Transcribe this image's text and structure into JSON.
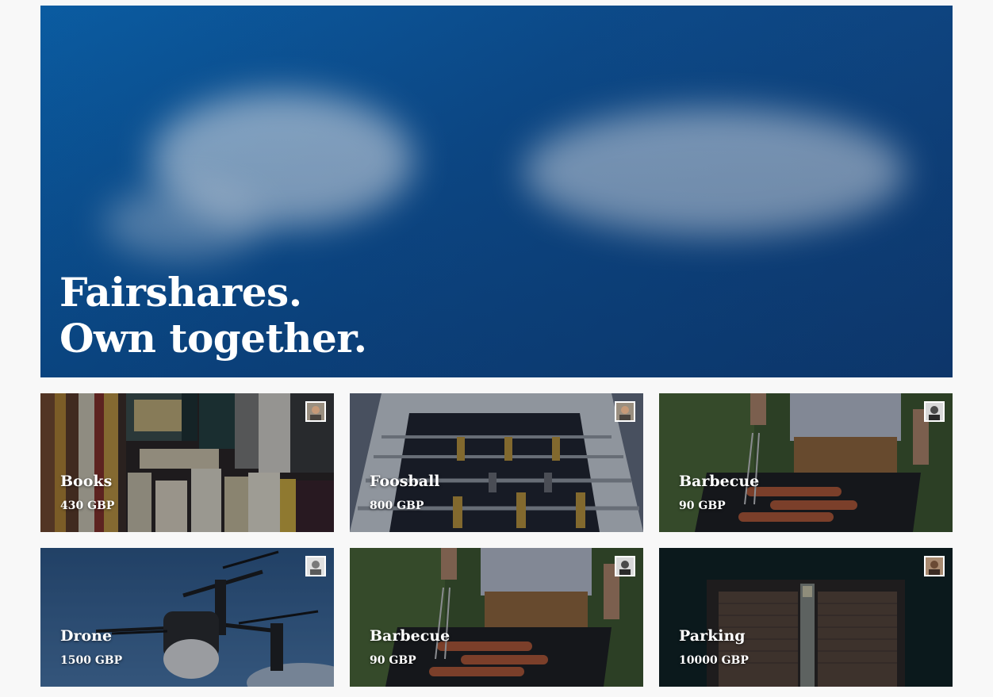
{
  "hero": {
    "line1": "Fairshares.",
    "line2": "Own together."
  },
  "listings": [
    {
      "name": "Books",
      "price": "430 GBP",
      "image": "books-shelf-photo",
      "owner_avatar": "user-avatar"
    },
    {
      "name": "Foosball",
      "price": "800 GBP",
      "image": "foosball-table-photo",
      "owner_avatar": "user-avatar"
    },
    {
      "name": "Barbecue",
      "price": "90 GBP",
      "image": "barbecue-grill-photo",
      "owner_avatar": "user-avatar"
    },
    {
      "name": "Drone",
      "price": "1500 GBP",
      "image": "drone-photo",
      "owner_avatar": "user-avatar"
    },
    {
      "name": "Barbecue",
      "price": "90 GBP",
      "image": "barbecue-grill-photo",
      "owner_avatar": "user-avatar"
    },
    {
      "name": "Parking",
      "price": "10000 GBP",
      "image": "parking-garage-photo",
      "owner_avatar": "user-avatar"
    }
  ],
  "colors": {
    "hero_blue": "#0d4c8c",
    "page_bg": "#f8f8f8",
    "text": "#ffffff"
  }
}
